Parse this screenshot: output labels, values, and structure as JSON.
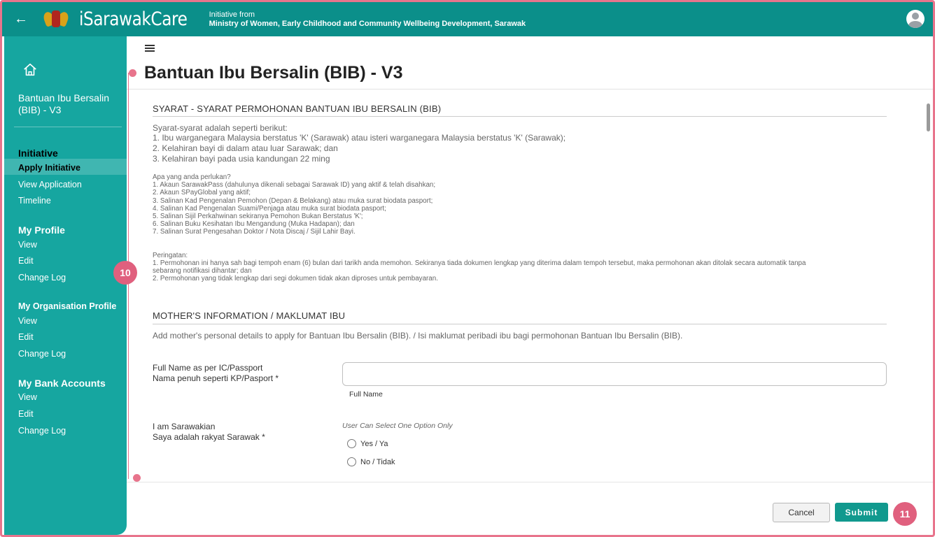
{
  "header": {
    "brand": "iSarawakCare",
    "initiative_line1": "Initiative from",
    "initiative_line2": "Ministry of Women, Early Childhood and Community Wellbeing Development, Sarawak"
  },
  "sidebar": {
    "title": "Bantuan Ibu Bersalin (BIB) - V3",
    "sections": [
      {
        "label": "Initiative",
        "items": [
          "Apply Initiative",
          "View Application",
          "Timeline"
        ]
      },
      {
        "label": "My Profile",
        "items": [
          "View",
          "Edit",
          "Change Log"
        ]
      },
      {
        "label": "My Organisation Profile",
        "items": [
          "View",
          "Edit",
          "Change Log"
        ]
      },
      {
        "label": "My Bank Accounts",
        "items": [
          "View",
          "Edit",
          "Change Log"
        ]
      }
    ],
    "active_item": "Apply Initiative"
  },
  "page": {
    "title": "Bantuan Ibu Bersalin (BIB) - V3"
  },
  "requirements": {
    "heading": "SYARAT - SYARAT PERMOHONAN BANTUAN IBU BERSALIN (BIB)",
    "intro": "Syarat-syarat adalah seperti berikut:",
    "conditions": [
      "1. Ibu warganegara Malaysia berstatus 'K' (Sarawak) atau isteri warganegara Malaysia berstatus 'K' (Sarawak);",
      "2. Kelahiran bayi di dalam atau luar Sarawak; dan",
      "3. Kelahiran bayi pada usia kandungan 22 ming"
    ],
    "needs_intro": "Apa yang anda perlukan?",
    "needs": [
      "1. Akaun SarawakPass (dahulunya dikenali sebagai Sarawak ID) yang aktif & telah disahkan;",
      "2. Akaun SPayGlobal yang aktif;",
      "3. Salinan Kad Pengenalan Pemohon (Depan & Belakang) atau muka surat biodata pasport;",
      "4. Salinan Kad Pengenalan Suami/Penjaga atau muka surat biodata pasport;",
      "5. Salinan Sijil Perkahwinan sekiranya Pemohon Bukan Berstatus 'K';",
      "6. Salinan Buku Kesihatan Ibu Mengandung (Muka Hadapan); dan",
      "7. Salinan Surat Pengesahan Doktor / Nota Discaj / Sijil Lahir Bayi."
    ],
    "warning_intro": "Peringatan:",
    "warnings": [
      "1. Permohonan ini hanya sah bagi tempoh enam (6) bulan dari tarikh anda memohon. Sekiranya tiada dokumen lengkap yang diterima dalam tempoh tersebut, maka permohonan akan ditolak secara automatik tanpa",
      "sebarang notifikasi dihantar; dan",
      "2. Permohonan yang tidak lengkap dari segi dokumen tidak akan diproses untuk pembayaran."
    ]
  },
  "mother_info": {
    "heading": "MOTHER'S INFORMATION / MAKLUMAT IBU",
    "description": "Add mother's personal details to apply for Bantuan Ibu Bersalin (BIB). / Isi maklumat peribadi ibu bagi permohonan Bantuan Ibu Bersalin (BIB).",
    "full_name_label_en": "Full Name as per IC/Passport",
    "full_name_label_ms": "Nama penuh seperti KP/Pasport *",
    "full_name_value": "",
    "full_name_hint": "Full Name",
    "sarawakian_label_en": "I am Sarawakian",
    "sarawakian_label_ms": "Saya adalah rakyat Sarawak *",
    "sarawakian_hint": "User Can Select One Option Only",
    "options": [
      "Yes / Ya",
      "No / Tidak"
    ]
  },
  "actions": {
    "cancel": "Cancel",
    "submit": "Submit"
  },
  "annotations": {
    "marker_10": "10",
    "marker_11": "11"
  }
}
